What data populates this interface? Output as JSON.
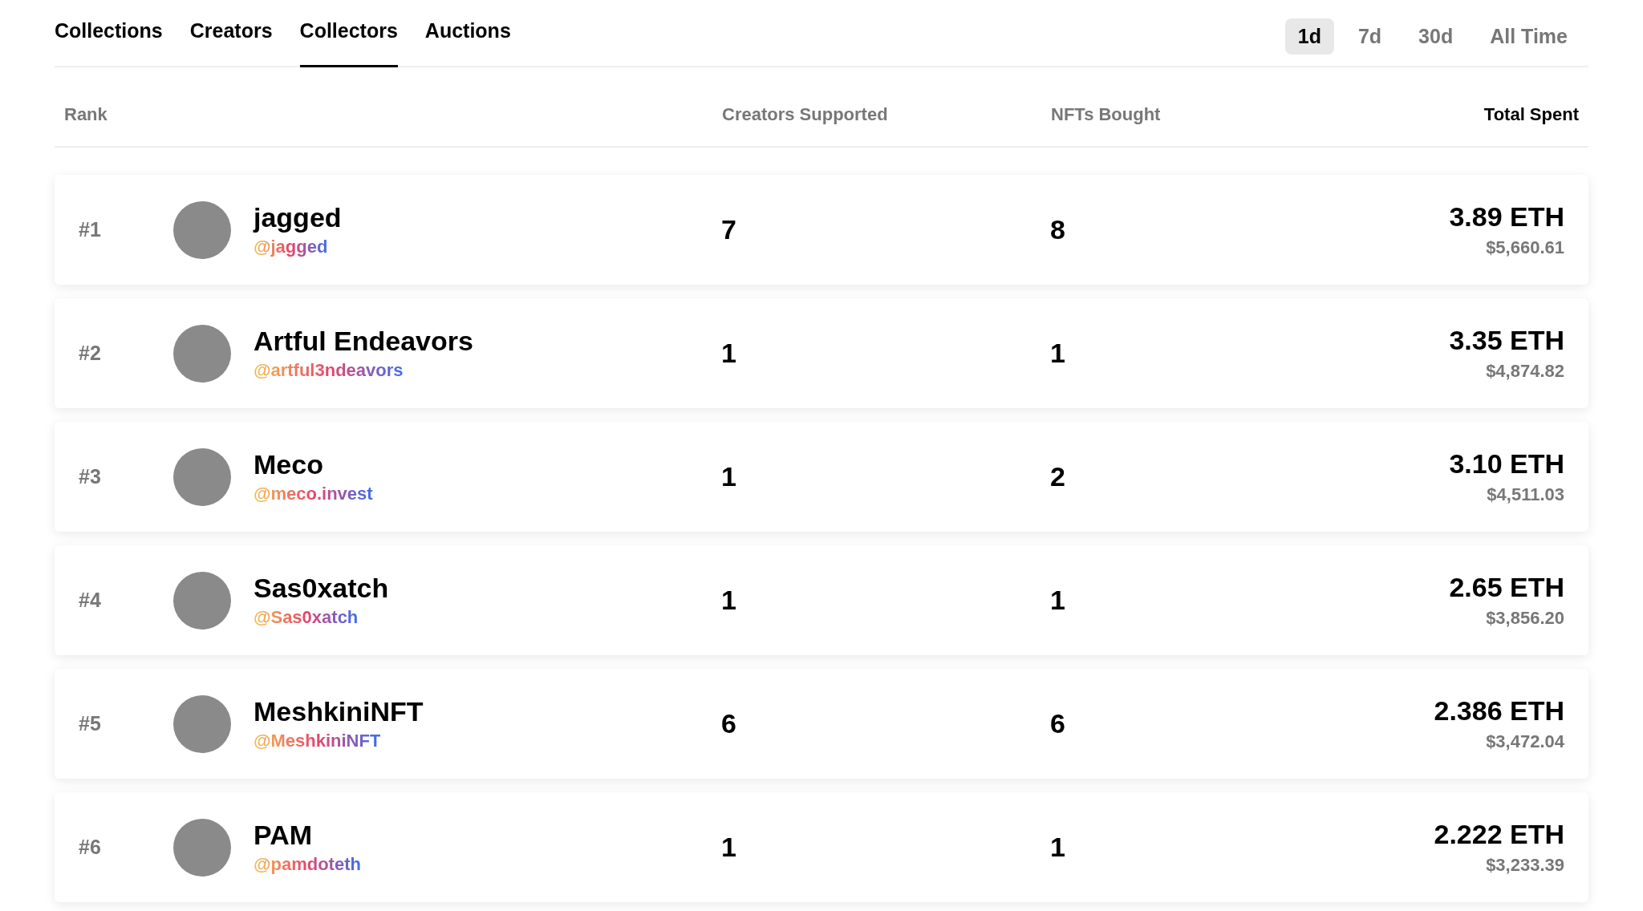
{
  "tabs": [
    {
      "label": "Collections",
      "selected": false
    },
    {
      "label": "Creators",
      "selected": false
    },
    {
      "label": "Collectors",
      "selected": true
    },
    {
      "label": "Auctions",
      "selected": false
    }
  ],
  "periods": [
    {
      "label": "1d",
      "selected": true
    },
    {
      "label": "7d",
      "selected": false
    },
    {
      "label": "30d",
      "selected": false
    },
    {
      "label": "All Time",
      "selected": false
    }
  ],
  "table": {
    "columns": [
      {
        "label": "Rank",
        "emphasized": false
      },
      {
        "label": "Creators Supported",
        "emphasized": false
      },
      {
        "label": "NFTs Bought",
        "emphasized": false
      },
      {
        "label": "Total Spent",
        "emphasized": true
      }
    ],
    "rows": [
      {
        "rank": "#1",
        "name": "jagged",
        "handle": "@jagged",
        "creators_supported": "7",
        "nfts_bought": "8",
        "eth": "3.89 ETH",
        "usd": "$5,660.61"
      },
      {
        "rank": "#2",
        "name": "Artful Endeavors",
        "handle": "@artful3ndeavors",
        "creators_supported": "1",
        "nfts_bought": "1",
        "eth": "3.35 ETH",
        "usd": "$4,874.82"
      },
      {
        "rank": "#3",
        "name": "Meco",
        "handle": "@meco.invest",
        "creators_supported": "1",
        "nfts_bought": "2",
        "eth": "3.10 ETH",
        "usd": "$4,511.03"
      },
      {
        "rank": "#4",
        "name": "Sas0xatch",
        "handle": "@Sas0xatch",
        "creators_supported": "1",
        "nfts_bought": "1",
        "eth": "2.65 ETH",
        "usd": "$3,856.20"
      },
      {
        "rank": "#5",
        "name": "MeshkiniNFT",
        "handle": "@MeshkiniNFT",
        "creators_supported": "6",
        "nfts_bought": "6",
        "eth": "2.386 ETH",
        "usd": "$3,472.04"
      },
      {
        "rank": "#6",
        "name": "PAM",
        "handle": "@pamdoteth",
        "creators_supported": "1",
        "nfts_bought": "1",
        "eth": "2.222 ETH",
        "usd": "$3,233.39"
      }
    ]
  }
}
